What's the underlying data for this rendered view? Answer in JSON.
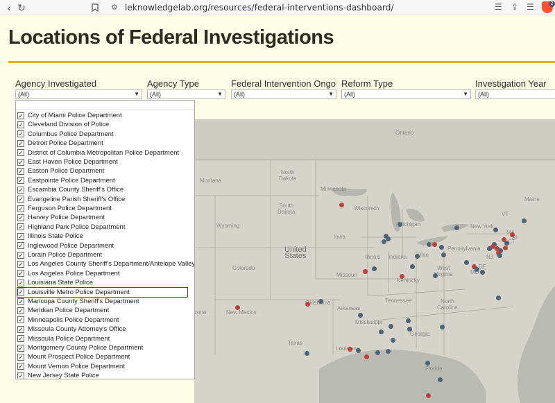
{
  "browser": {
    "url": "leknowledgelab.org/resources/federal-interventions-dashboard/",
    "badge_count": "2"
  },
  "page": {
    "title": "Locations of Federal Investigations"
  },
  "filters": [
    {
      "label": "Agency Investigated",
      "value": "(All)"
    },
    {
      "label": "Agency Type",
      "value": "(All)"
    },
    {
      "label": "Federal Intervention Ongoi…",
      "value": "(All)"
    },
    {
      "label": "Reform Type",
      "value": "(All)"
    },
    {
      "label": "Investigation Year",
      "value": "(All)"
    }
  ],
  "dropdown": {
    "items": [
      "City of Miami Police Department",
      "Cleveland Division of Police",
      "Columbus Police Department",
      "Detroit Police Department",
      "District of Columbia Metropolitan Police Department",
      "East Haven Police Department",
      "Easton Police Department",
      "Eastpointe Police Department",
      "Escambia County Sheriff's Office",
      "Evangeline Parish Sheriff's Office",
      "Ferguson Police Department",
      "Harvey Police Department",
      "Highland Park Police Department",
      "Illinois State Police",
      "Inglewood Police Department",
      "Lorain Police Department",
      "Los Angeles County Sheriff's Department/Antelope Valley",
      "Los Angeles Police Department",
      "Louisiana State Police",
      "Louisville Metro Police Department",
      "Maricopa County Sheriff's Department",
      "Meridian Police Department",
      "Minneapolis Police Department",
      "Missoula County Attorney's Office",
      "Missoula Police Department",
      "Montgomery County Police Department",
      "Mount Prospect Police Department",
      "Mount Vernon Police Department",
      "New Jersey State Police"
    ],
    "checkmark": "✓",
    "selected_index": 19
  },
  "map": {
    "labels": {
      "ontario": "Ontario",
      "north_dakota": "North\nDakota",
      "montana": "Montana",
      "minnesota": "Minnesota",
      "wisconsin": "Wisconsin",
      "south_dakota": "South\nDakota",
      "wyoming": "Wyoming",
      "michigan": "Michigan",
      "iowa": "Iowa",
      "united_states": "United\nStates",
      "colorado": "Colorado",
      "illinois": "Illinois",
      "indiana": "Indiana",
      "ohio": "Ohio",
      "pennsylvania": "Pennsylvania",
      "new_york": "New York",
      "vermont": "VT",
      "maine": "Maine",
      "missouri": "Missouri",
      "kentucky": "Kentucky",
      "west_virginia": "West\nVirginia",
      "new_mexico": "New Mexico",
      "oklahoma": "Oklahoma",
      "arkansas": "Arkansas",
      "tennessee": "Tennessee",
      "north_carolina": "North\nCarolina",
      "mississippi": "Mississippi",
      "georgia": "Georgia",
      "texas": "Texas",
      "louisiana": "Louisiana",
      "florida": "Florida",
      "arizona": "zona",
      "massachusetts": "MA",
      "nj": "NJ",
      "md": "MD",
      "de": "DE",
      "ct": "CT",
      "ri": "RI"
    },
    "colors": {
      "blue_marker": "#4b6478",
      "red_marker": "#c0403c"
    }
  }
}
